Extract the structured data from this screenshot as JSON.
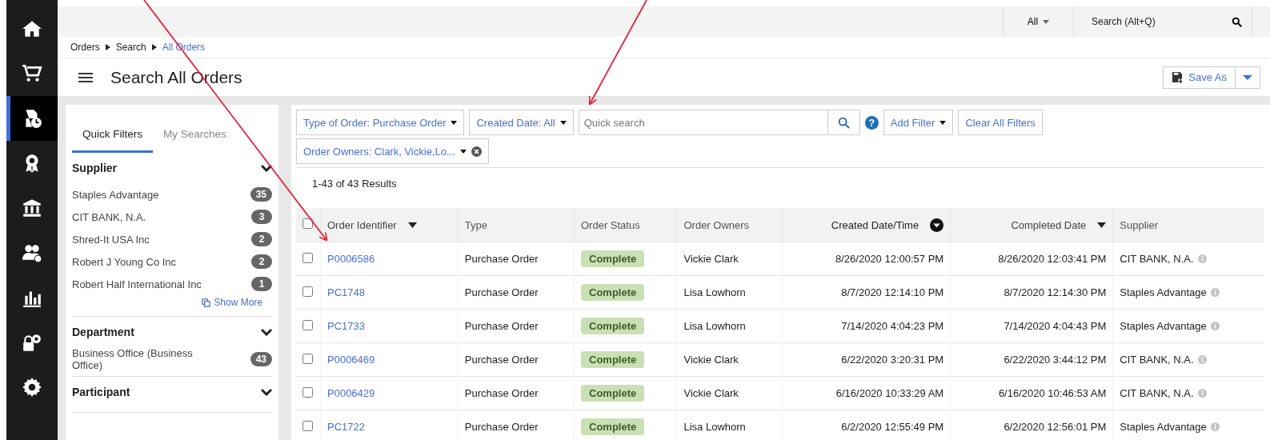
{
  "top_bar": {
    "scope": "All",
    "search_placeholder": "Search (Alt+Q)"
  },
  "nav_items": [
    {
      "selected": false
    },
    {
      "selected": false
    },
    {
      "selected": true
    },
    {
      "selected": false
    },
    {
      "selected": false
    },
    {
      "selected": false
    },
    {
      "selected": false
    },
    {
      "selected": false
    },
    {
      "selected": false
    }
  ],
  "breadcrumb": [
    {
      "label": "Orders",
      "link": false
    },
    {
      "label": "Search",
      "link": false
    },
    {
      "label": "All Orders",
      "link": true
    }
  ],
  "page_title": "Search All Orders",
  "save_button": "Save As",
  "side_tabs": [
    {
      "label": "Quick Filters",
      "selected": true
    },
    {
      "label": "My Searches",
      "selected": false
    }
  ],
  "filter_groups": [
    {
      "title": "Supplier",
      "expanded": true,
      "items": [
        {
          "label": "Staples Advantage",
          "count": "35"
        },
        {
          "label": "CIT BANK, N.A.",
          "count": "3"
        },
        {
          "label": "Shred-It USA Inc",
          "count": "2"
        },
        {
          "label": "Robert J Young Co Inc",
          "count": "2"
        },
        {
          "label": "Robert Half International Inc",
          "count": "1"
        }
      ],
      "show_more": "Show More"
    },
    {
      "title": "Department",
      "expanded": true,
      "items": [
        {
          "label": "Business Office (Business Office)",
          "count": "43"
        }
      ]
    },
    {
      "title": "Participant",
      "expanded": true
    }
  ],
  "filters": [
    {
      "label": "Type of Order: Purchase Order"
    },
    {
      "label": "Created Date: All"
    }
  ],
  "quick_search": {
    "placeholder": "Quick search"
  },
  "help": "?",
  "add_filter": "Add Filter",
  "clear_filters": "Clear All Filters",
  "owner_filter": {
    "label": "Order Owners:  Clark, Vickie,Lo...",
    "removable": true
  },
  "results": "1-43 of 43 Results",
  "table": {
    "select_all": false,
    "columns": [
      {
        "label": "Order Identifier",
        "sortable": true,
        "sorted": false
      },
      {
        "label": "Type",
        "sortable": false,
        "sorted": false
      },
      {
        "label": "Order Status",
        "sortable": false,
        "sorted": false
      },
      {
        "label": "Order Owners",
        "sortable": false,
        "sorted": false
      },
      {
        "label": "Created Date/Time",
        "sortable": true,
        "sorted": true
      },
      {
        "label": "Completed Date",
        "sortable": true,
        "sorted": false
      },
      {
        "label": "Supplier",
        "sortable": false,
        "sorted": false
      }
    ],
    "rows": [
      {
        "checked": false,
        "id": "P0006586",
        "type": "Purchase Order",
        "status": "Complete",
        "owner": "Vickie Clark",
        "created": "8/26/2020 12:00:57 PM",
        "completed": "8/26/2020 12:03:41 PM",
        "supplier": "CIT BANK, N.A."
      },
      {
        "checked": false,
        "id": "PC1748",
        "type": "Purchase Order",
        "status": "Complete",
        "owner": "Lisa Lowhorn",
        "created": "8/7/2020 12:14:10 PM",
        "completed": "8/7/2020 12:14:30 PM",
        "supplier": "Staples Advantage"
      },
      {
        "checked": false,
        "id": "PC1733",
        "type": "Purchase Order",
        "status": "Complete",
        "owner": "Lisa Lowhorn",
        "created": "7/14/2020 4:04:23 PM",
        "completed": "7/14/2020 4:04:43 PM",
        "supplier": "Staples Advantage"
      },
      {
        "checked": false,
        "id": "P0006469",
        "type": "Purchase Order",
        "status": "Complete",
        "owner": "Vickie Clark",
        "created": "6/22/2020 3:20:31 PM",
        "completed": "6/22/2020 3:44:12 PM",
        "supplier": "CIT BANK, N.A."
      },
      {
        "checked": false,
        "id": "P0006429",
        "type": "Purchase Order",
        "status": "Complete",
        "owner": "Vickie Clark",
        "created": "6/16/2020 10:33:29 AM",
        "completed": "6/16/2020 10:46:53 AM",
        "supplier": "CIT BANK, N.A."
      },
      {
        "checked": false,
        "id": "PC1722",
        "type": "Purchase Order",
        "status": "Complete",
        "owner": "Lisa Lowhorn",
        "created": "6/2/2020 12:55:49 PM",
        "completed": "6/2/2020 12:56:01 PM",
        "supplier": "Staples Advantage"
      }
    ]
  }
}
